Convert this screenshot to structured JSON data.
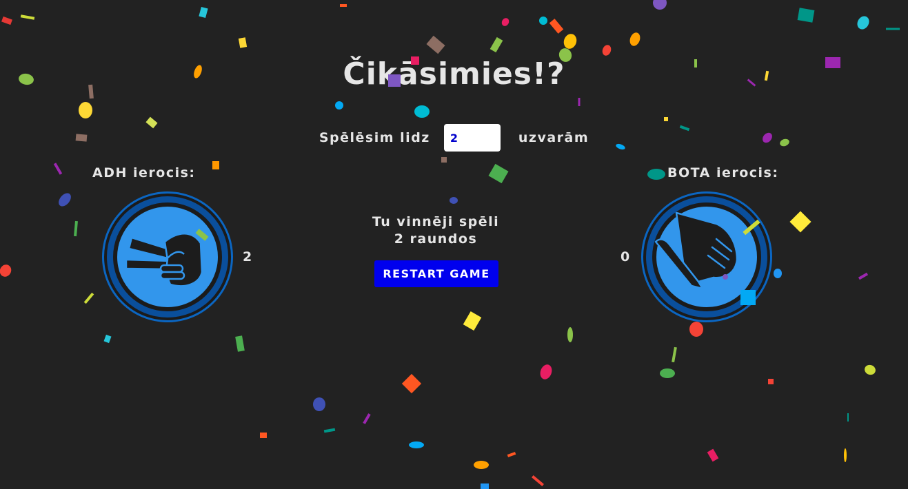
{
  "title": "Čikāsimies!?",
  "settings": {
    "label_before": "Spēlēsim lidz",
    "rounds_value": "2",
    "label_after": "uzvarām"
  },
  "player": {
    "label": "ADH ierocis:",
    "score": "2",
    "weapon_icon": "scissors-hand-icon"
  },
  "bot": {
    "label": "BOTA ierocis:",
    "score": "0",
    "weapon_icon": "paper-hand-icon"
  },
  "result": {
    "line1": "Tu vinnēji spēli",
    "line2": "2 raundos"
  },
  "restart_label": "RESTART GAME",
  "colors": {
    "background": "#222222",
    "text": "#e6e6e6",
    "button": "#0000ee",
    "icon_fill": "#3296ec",
    "icon_ring": "#0a4f9c",
    "icon_dark": "#1c1c1c"
  }
}
